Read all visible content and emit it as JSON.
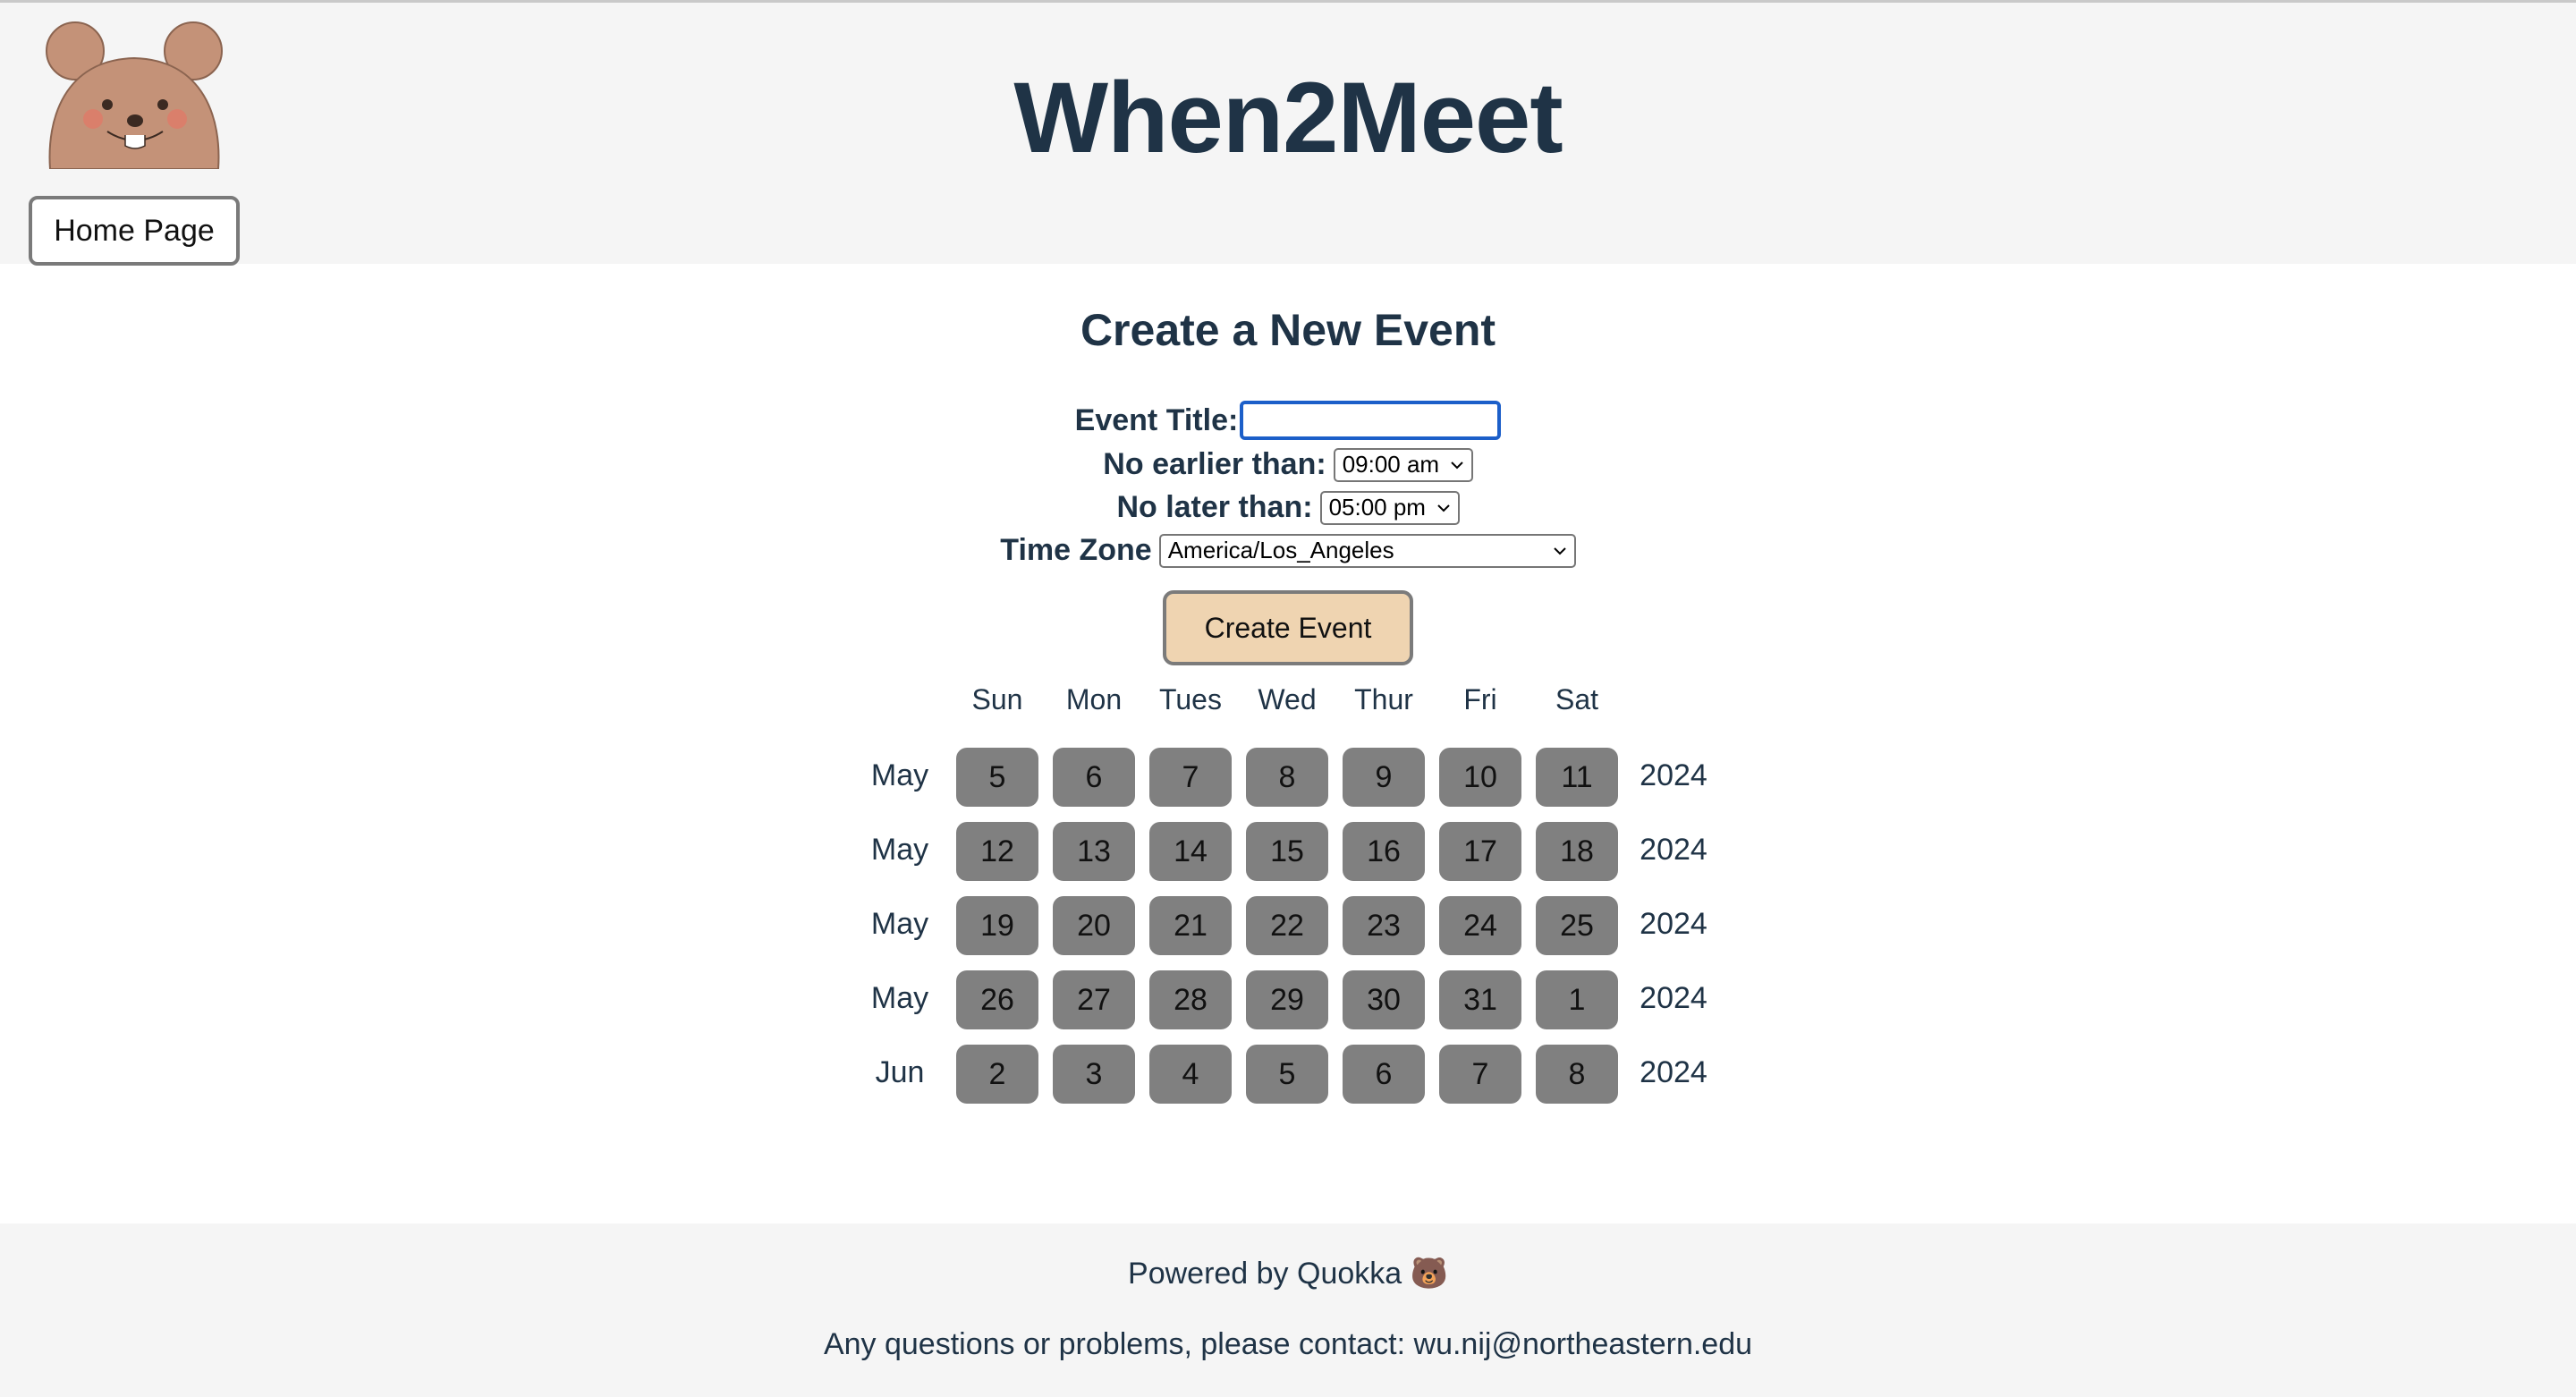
{
  "header": {
    "title": "When2Meet",
    "home_button": "Home Page",
    "logo_icon": "quokka-face-icon"
  },
  "form": {
    "heading": "Create a New Event",
    "event_title_label": "Event Title:",
    "event_title_value": "",
    "no_earlier_label": "No earlier than:",
    "no_earlier_value": "09:00 am",
    "no_later_label": "No later than:",
    "no_later_value": "05:00 pm",
    "timezone_label": "Time Zone",
    "timezone_value": "America/Los_Angeles",
    "create_button": "Create Event"
  },
  "calendar": {
    "weekdays": [
      "Sun",
      "Mon",
      "Tues",
      "Wed",
      "Thur",
      "Fri",
      "Sat"
    ],
    "weeks": [
      {
        "month": "May",
        "year": "2024",
        "days": [
          "5",
          "6",
          "7",
          "8",
          "9",
          "10",
          "11"
        ]
      },
      {
        "month": "May",
        "year": "2024",
        "days": [
          "12",
          "13",
          "14",
          "15",
          "16",
          "17",
          "18"
        ]
      },
      {
        "month": "May",
        "year": "2024",
        "days": [
          "19",
          "20",
          "21",
          "22",
          "23",
          "24",
          "25"
        ]
      },
      {
        "month": "May",
        "year": "2024",
        "days": [
          "26",
          "27",
          "28",
          "29",
          "30",
          "31",
          "1"
        ]
      },
      {
        "month": "Jun",
        "year": "2024",
        "days": [
          "2",
          "3",
          "4",
          "5",
          "6",
          "7",
          "8"
        ]
      }
    ],
    "day_color": "#808080"
  },
  "footer": {
    "powered_by": "Powered by Quokka 🐻",
    "contact": "Any questions or problems, please contact: wu.nij@northeastern.edu"
  },
  "colors": {
    "text": "#1f3346",
    "header_bg": "#f5f5f5",
    "create_button_bg": "#efd4b1",
    "input_focus": "#1c5fc9"
  }
}
